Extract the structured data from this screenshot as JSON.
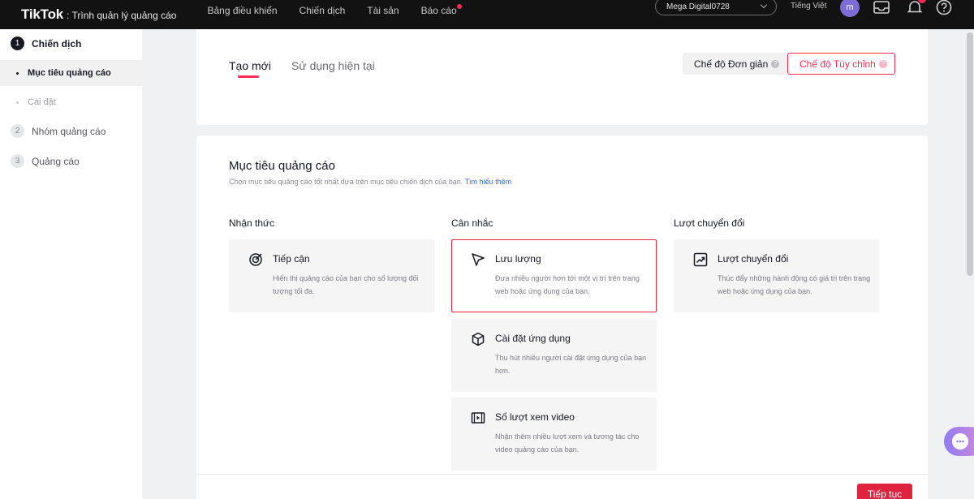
{
  "header": {
    "logo": "TikTok",
    "logo_sub": ": Trình quản lý quảng cáo",
    "nav": [
      "Bảng điều khiển",
      "Chiến dịch",
      "Tài sản",
      "Báo cáo"
    ],
    "account": "Mega Digital0728",
    "language": "Tiếng Việt",
    "avatar_letter": "m",
    "icons": [
      "inbox-icon",
      "bell-icon",
      "help-icon"
    ],
    "badge_color": "#fe2c55"
  },
  "sidebar": {
    "steps": [
      {
        "num": "1",
        "label": "Chiến dịch"
      },
      {
        "num": "2",
        "label": "Nhóm quảng cáo"
      },
      {
        "num": "3",
        "label": "Quảng cáo"
      }
    ],
    "substeps": [
      "Mục tiêu quảng cáo",
      "Cài đặt"
    ]
  },
  "top_panel": {
    "tabs": [
      "Tạo mới",
      "Sử dụng hiện tại"
    ],
    "mode_simple": "Chế độ Đơn giản",
    "mode_custom": "Chế độ Tùy chỉnh",
    "help_glyph": "?"
  },
  "objective": {
    "title": "Mục tiêu quảng cáo",
    "description": "Chọn mục tiêu quảng cáo tốt nhất dựa trên mục tiêu chiến dịch của bạn.",
    "learn_more": "Tìm hiểu thêm",
    "columns": [
      {
        "heading": "Nhận thức",
        "cards": [
          {
            "title": "Tiếp cận",
            "desc": "Hiển thị quảng cáo của bạn cho số lượng đối tượng tối đa.",
            "icon": "target-icon"
          }
        ]
      },
      {
        "heading": "Cân nhắc",
        "cards": [
          {
            "title": "Lưu lượng",
            "desc": "Đưa nhiều người hơn tới một vị trí trên trang web hoặc ứng dụng của bạn.",
            "icon": "cursor-icon",
            "selected": true
          },
          {
            "title": "Cài đặt ứng dụng",
            "desc": "Thu hút nhiều người cài đặt ứng dụng của bạn hơn.",
            "icon": "box-icon"
          },
          {
            "title": "Số lượt xem video",
            "desc": "Nhận thêm nhiều lượt xem và tương tác cho video quảng cáo của bạn.",
            "icon": "video-icon"
          }
        ]
      },
      {
        "heading": "Lượt chuyển đổi",
        "cards": [
          {
            "title": "Lượt chuyển đổi",
            "desc": "Thúc đẩy những hành động có giá trị trên trang web hoặc ứng dụng của bạn.",
            "icon": "trend-up-icon"
          }
        ]
      }
    ],
    "continue": "Tiếp tục"
  },
  "colors": {
    "accent": "#fe2c55",
    "selected_border": "#e0243f",
    "link": "#2f6ce5"
  }
}
